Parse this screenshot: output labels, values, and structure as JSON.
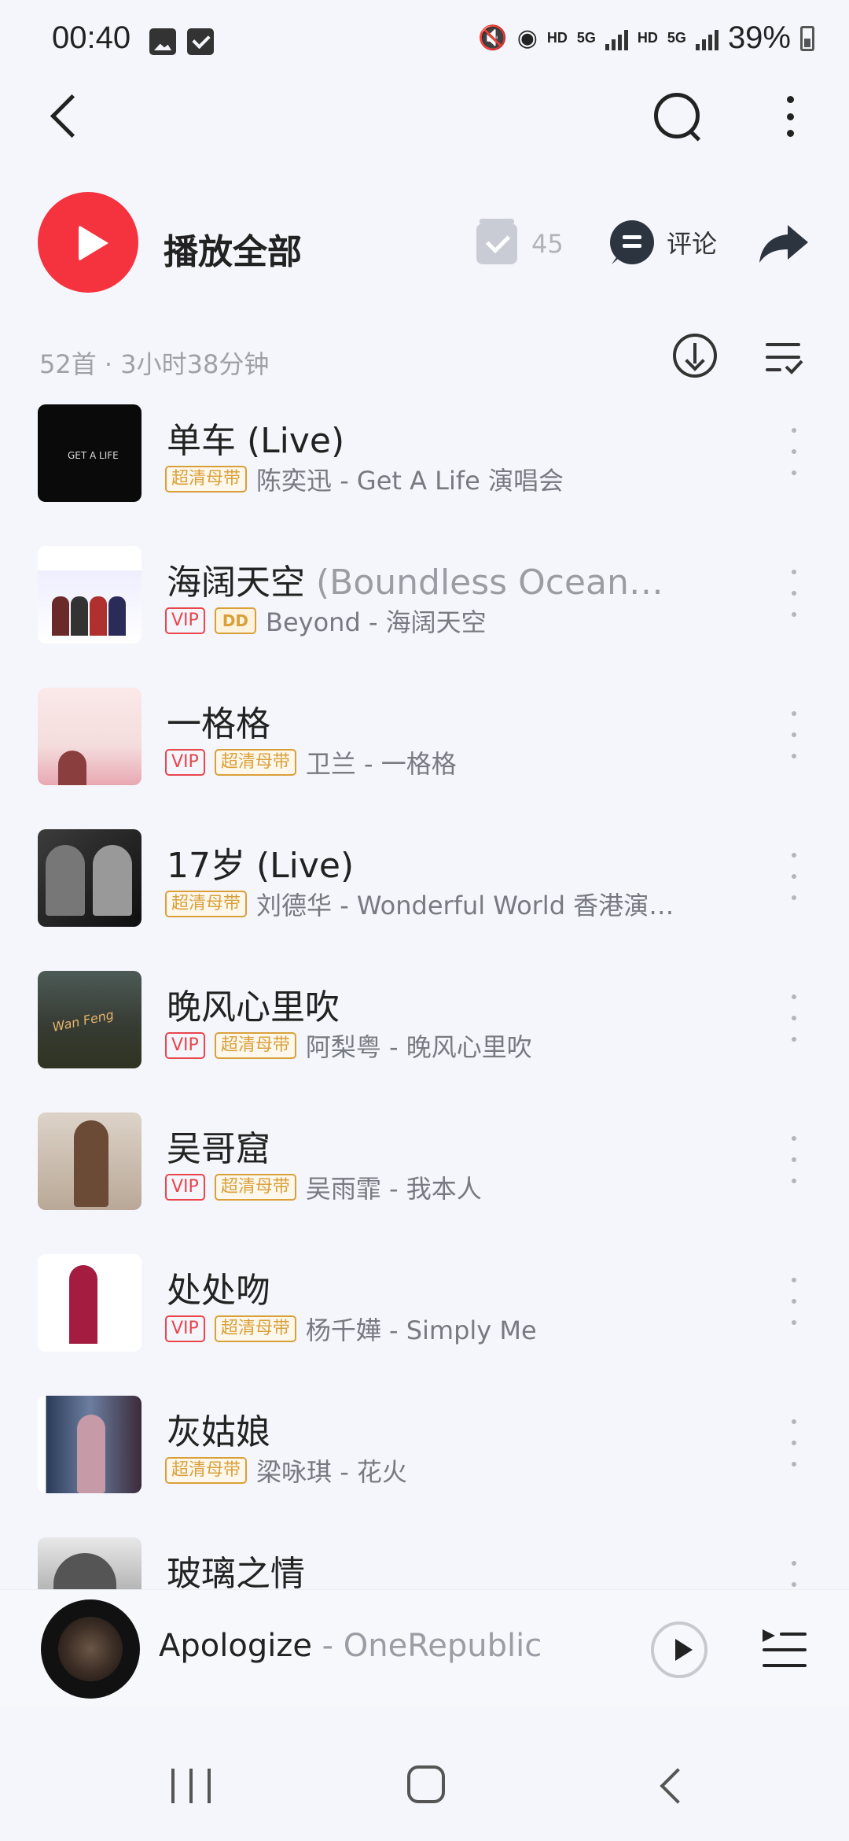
{
  "status_bar": {
    "time": "00:40",
    "hd1": "HD",
    "net": "5G",
    "hd2": "HD",
    "net2": "5G",
    "battery": "39%"
  },
  "top_nav": {
    "back_icon": "chevron-left-icon",
    "search_icon": "search-icon",
    "more_icon": "vertical-dots-icon"
  },
  "action_bar": {
    "play_all_label": "播放全部",
    "collect_count": "45",
    "comment_label": "评论",
    "accent_color": "#f5333f"
  },
  "list_meta": {
    "summary": "52首 · 3小时38分钟"
  },
  "badges": {
    "vip": "VIP",
    "hq": "超清母带",
    "dolby": "DD"
  },
  "songs": [
    {
      "title": "单车 (Live)",
      "subtitle": "",
      "badges": [
        "hq"
      ],
      "artist": "陈奕迅 - Get A Life 演唱会"
    },
    {
      "title": "海阔天空",
      "subtitle": " (Boundless Ocean…",
      "badges": [
        "vip",
        "dolby"
      ],
      "artist": "Beyond - 海阔天空"
    },
    {
      "title": "一格格",
      "subtitle": "",
      "badges": [
        "vip",
        "hq"
      ],
      "artist": "卫兰 - 一格格"
    },
    {
      "title": "17岁 (Live)",
      "subtitle": "",
      "badges": [
        "hq"
      ],
      "artist": "刘德华 - Wonderful World 香港演唱…"
    },
    {
      "title": "晚风心里吹",
      "subtitle": "",
      "badges": [
        "vip",
        "hq"
      ],
      "artist": "阿梨粤 - 晚风心里吹"
    },
    {
      "title": "吴哥窟",
      "subtitle": "",
      "badges": [
        "vip",
        "hq"
      ],
      "artist": "吴雨霏 - 我本人"
    },
    {
      "title": "处处吻",
      "subtitle": "",
      "badges": [
        "vip",
        "hq"
      ],
      "artist": "杨千嬅 - Simply Me"
    },
    {
      "title": "灰姑娘",
      "subtitle": "",
      "badges": [
        "hq"
      ],
      "artist": "梁咏琪 - 花火"
    },
    {
      "title": "玻璃之情",
      "subtitle": "",
      "badges": [],
      "artist": ""
    }
  ],
  "mini_player": {
    "title": "Apologize",
    "separator": " - ",
    "artist": "OneRepublic"
  }
}
